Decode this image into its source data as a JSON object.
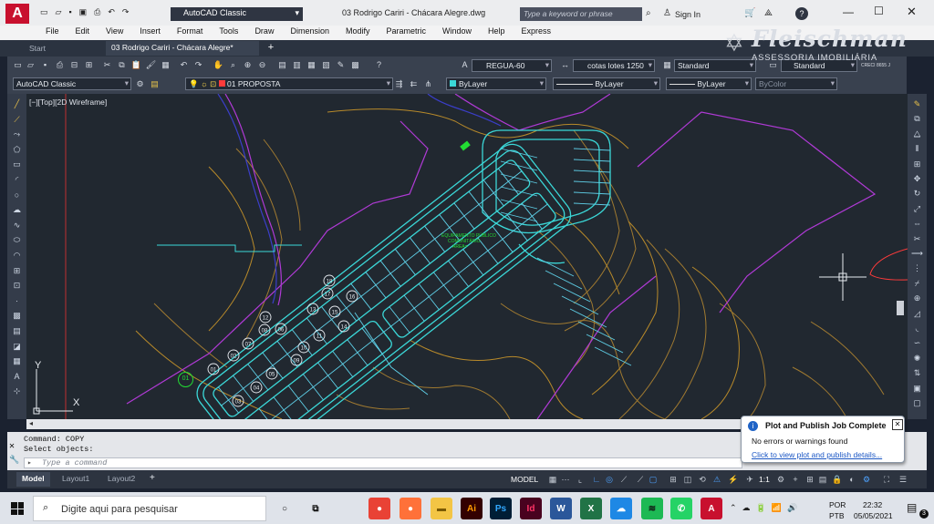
{
  "titlebar": {
    "workspace": "AutoCAD Classic",
    "document_title": "03 Rodrigo Cariri - Chácara Alegre.dwg",
    "search_placeholder": "Type a keyword or phrase",
    "sign_in": "Sign In",
    "help": "?"
  },
  "menu": [
    "File",
    "Edit",
    "View",
    "Insert",
    "Format",
    "Tools",
    "Draw",
    "Dimension",
    "Modify",
    "Parametric",
    "Window",
    "Help",
    "Express"
  ],
  "tabs": {
    "start": "Start",
    "drawing": "03 Rodrigo Cariri - Chácara Alegre*"
  },
  "watermark": {
    "name": "Fleischman",
    "subtitle": "ASSESSORIA IMOBILIÁRIA",
    "creci": "CRECI 8655 J"
  },
  "toolbar1": {
    "text_style": "REGUA-60",
    "dim_style": "cotas lotes 1250",
    "table_style": "Standard",
    "mleader_style": "Standard"
  },
  "toolbar2": {
    "workspace": "AutoCAD Classic",
    "layer": "01 PROPOSTA",
    "color": "ByLayer",
    "linetype": "ByLayer",
    "lineweight": "ByLayer",
    "plotstyle": "ByColor"
  },
  "viewport": {
    "label": "[−][Top][2D Wireframe]",
    "axis_y": "Y",
    "axis_x": "X",
    "area_label_1": "EQUIPAMENTO PÚBLICO",
    "area_label_2": "COMUNITÁRIO",
    "area_label_3": "AREA=",
    "lot_numbers": [
      "01",
      "02",
      "03",
      "04",
      "05",
      "06",
      "07",
      "08",
      "09",
      "10",
      "11",
      "12",
      "13",
      "14",
      "15",
      "16",
      "17",
      "18"
    ],
    "corner_lot": "01",
    "colors": {
      "street": "#3bd8d8",
      "contour": "#b88a2a",
      "boundary": "#b03ad6",
      "lots": "#5fd0e8",
      "green": "#22dd33"
    }
  },
  "command": {
    "line1": "Command:  COPY",
    "line2": "Select objects:",
    "placeholder": "Type a command"
  },
  "layout_tabs": [
    "Model",
    "Layout1",
    "Layout2"
  ],
  "statusbar": {
    "model": "MODEL",
    "scale": "1:1"
  },
  "notification": {
    "title": "Plot and Publish Job Complete",
    "message": "No errors or warnings found",
    "link": "Click to view plot and publish details..."
  },
  "taskbar": {
    "search_placeholder": "Digite aqui para pesquisar",
    "lang1": "POR",
    "lang2": "PTB",
    "time": "22:32",
    "date": "05/05/2021",
    "badge": "3"
  }
}
